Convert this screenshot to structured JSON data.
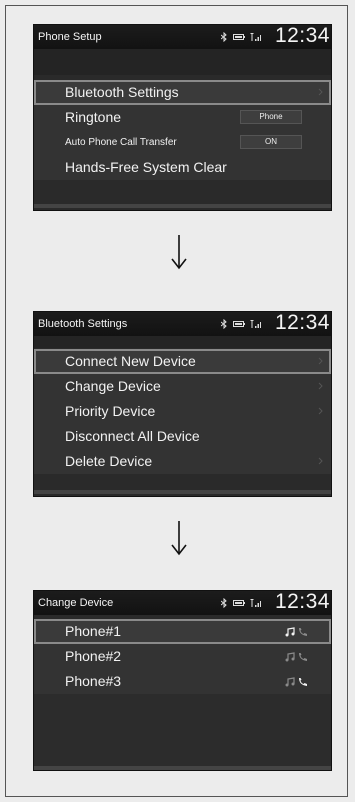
{
  "screens": [
    {
      "title": "Phone Setup",
      "time": "12:34",
      "items": [
        {
          "label": "Bluetooth Settings"
        },
        {
          "label": "Ringtone",
          "value": "Phone"
        },
        {
          "label": "Auto Phone Call Transfer",
          "value": "ON"
        },
        {
          "label": "Hands-Free System Clear"
        }
      ]
    },
    {
      "title": "Bluetooth Settings",
      "time": "12:34",
      "items": [
        {
          "label": "Connect New Device"
        },
        {
          "label": "Change Device"
        },
        {
          "label": "Priority Device"
        },
        {
          "label": "Disconnect All Device"
        },
        {
          "label": "Delete Device"
        }
      ]
    },
    {
      "title": "Change Device",
      "time": "12:34",
      "items": [
        {
          "label": "Phone#1"
        },
        {
          "label": "Phone#2"
        },
        {
          "label": "Phone#3"
        }
      ]
    }
  ],
  "icons": {
    "bluetooth": "bluetooth-icon",
    "battery": "battery-icon",
    "signal": "signal-icon",
    "music": "music-icon",
    "phone": "phone-icon",
    "arrow": "down-arrow-icon"
  }
}
